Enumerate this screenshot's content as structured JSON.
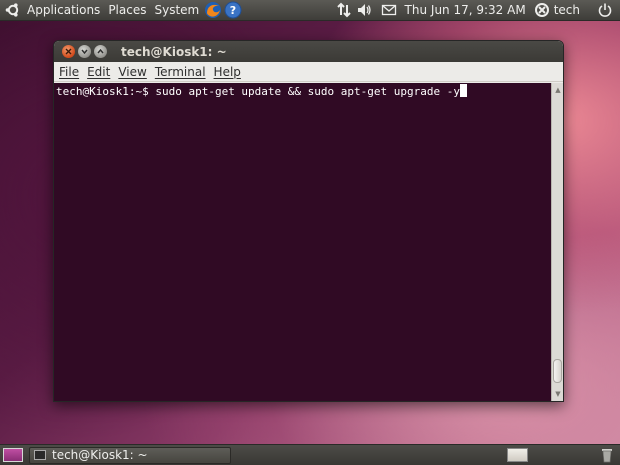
{
  "top_panel": {
    "menus": [
      "Applications",
      "Places",
      "System"
    ],
    "clock": "Thu Jun 17,  9:32 AM",
    "user": "tech",
    "icons": [
      "ubuntu-logo-icon",
      "firefox-icon",
      "help-icon",
      "network-icon",
      "volume-icon",
      "mail-icon",
      "user-status-icon",
      "power-icon"
    ]
  },
  "window": {
    "title": "tech@Kiosk1: ~",
    "menu": [
      {
        "label": "File"
      },
      {
        "label": "Edit"
      },
      {
        "label": "View"
      },
      {
        "label": "Terminal"
      },
      {
        "label": "Help"
      }
    ],
    "terminal": {
      "prompt": "tech@Kiosk1:~$ ",
      "command": "sudo apt-get update && sudo apt-get upgrade -y"
    }
  },
  "bottom_panel": {
    "task_label": "tech@Kiosk1: ~"
  },
  "colors": {
    "terminal_bg": "#300a24",
    "close_button": "#d2491a"
  }
}
